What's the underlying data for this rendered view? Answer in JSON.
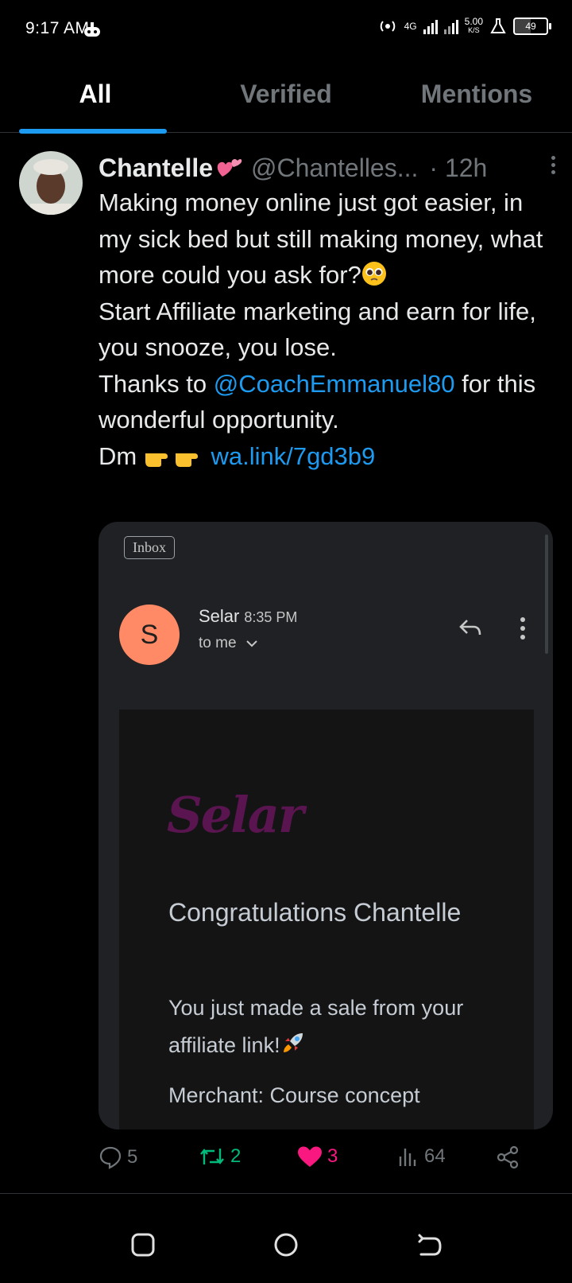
{
  "status_bar": {
    "time": "9:17 AM",
    "network": "4G",
    "speed": "5.00",
    "speed_unit": "K/S",
    "battery": "49"
  },
  "tabs": [
    {
      "label": "All",
      "active": true
    },
    {
      "label": "Verified",
      "active": false
    },
    {
      "label": "Mentions",
      "active": false
    }
  ],
  "tweet": {
    "author_name": "Chantelle",
    "handle": "@Chantelles...",
    "time": "· 12h",
    "line1": "Making money online just got easier, in my sick bed but still making money, what more could you ask for?",
    "line2": "Start Affiliate marketing and earn for life, you snooze, you lose.",
    "line3_before": "Thanks to ",
    "line3_mention": "@CoachEmmanuel80",
    "line3_after": " for this wonderful opportunity.",
    "line4_prefix": "Dm ",
    "line4_link": "wa.link/7gd3b9"
  },
  "email": {
    "label_chip": "Inbox",
    "avatar_letter": "S",
    "sender": "Selar",
    "sent_time": "8:35 PM",
    "recipient": "to me",
    "logo_text": "Selar",
    "heading": "Congratulations Chantelle",
    "message": "You just made a sale from your affiliate link!",
    "merchant": "Merchant: Course concept"
  },
  "actions": {
    "replies": "5",
    "retweets": "2",
    "likes": "3",
    "views": "64"
  },
  "colors": {
    "accent": "#1d9bf0",
    "retweet": "#00ba7c",
    "like": "#f91880",
    "muted": "#71767b"
  }
}
